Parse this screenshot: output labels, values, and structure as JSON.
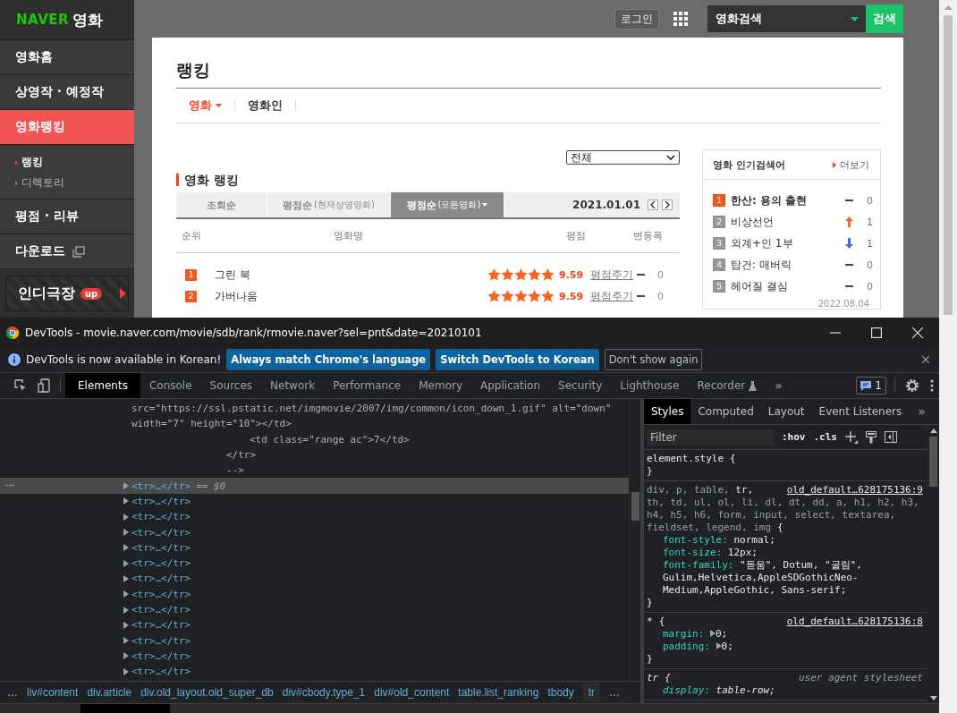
{
  "header": {
    "login": "로그인",
    "search": {
      "value": "영화검색",
      "button": "검색"
    }
  },
  "sidebar": {
    "logo": {
      "brand": "NAVER",
      "service": "영화"
    },
    "items": [
      {
        "label": "영화홈",
        "selected": false
      },
      {
        "label": "상영작 · 예정작",
        "selected": false
      },
      {
        "label": "영화랭킹",
        "selected": true,
        "children": [
          {
            "label": "랭킹",
            "selected": true
          },
          {
            "label": "디렉토리",
            "selected": false
          }
        ]
      },
      {
        "label": "평점 · 리뷰",
        "selected": false
      },
      {
        "label": "다운로드",
        "selected": false,
        "kind": "external"
      }
    ],
    "promo": {
      "label": "인디극장",
      "badge": "up"
    }
  },
  "page": {
    "title": "랭킹",
    "tabs": [
      {
        "label": "영화",
        "selected": true
      },
      {
        "label": "영화인",
        "selected": false
      }
    ],
    "filter": "전체",
    "ranking": {
      "title": "영화 랭킹",
      "sorts": [
        {
          "label": "조회순",
          "selected": false
        },
        {
          "label": "평점순",
          "note": "(현재상영영화)",
          "selected": false
        },
        {
          "label": "평점순",
          "note": "(모든영화)",
          "selected": true
        }
      ],
      "date": "2021.01.01",
      "columns": [
        "순위",
        "영화명",
        "평점",
        "변동폭"
      ],
      "rows": [
        {
          "rank": "1",
          "title": "그린 북",
          "stars": 5,
          "score": "9.59",
          "action": "평점주기",
          "kind": "same",
          "change": "0"
        },
        {
          "rank": "2",
          "title": "가버나움",
          "stars": 5,
          "score": "9.59",
          "action": "평점주기",
          "kind": "same",
          "change": "0"
        }
      ]
    },
    "popular": {
      "title": "영화 인기검색어",
      "more": "더보기",
      "items": [
        {
          "rank": "1",
          "title": "한산: 용의 출현",
          "selected": true,
          "kind": "same",
          "change": "0"
        },
        {
          "rank": "2",
          "title": "비상선언",
          "selected": false,
          "kind": "up",
          "change": "1"
        },
        {
          "rank": "3",
          "title": "외계+인 1부",
          "selected": false,
          "kind": "down",
          "change": "1"
        },
        {
          "rank": "4",
          "title": "탑건: 매버릭",
          "selected": false,
          "kind": "same",
          "change": "0"
        },
        {
          "rank": "5",
          "title": "헤어질 결심",
          "selected": false,
          "kind": "same",
          "change": "0"
        }
      ],
      "date": "2022.08.04"
    }
  },
  "devtools": {
    "title": "DevTools - movie.naver.com/movie/sdb/rank/rmovie.naver?sel=pnt&date=20210101",
    "infobar": {
      "message": "DevTools is now available in Korean!",
      "buttons": [
        {
          "label": "Always match Chrome's language",
          "kind": "primary"
        },
        {
          "label": "Switch DevTools to Korean",
          "kind": "primary"
        },
        {
          "label": "Don't show again",
          "kind": "secondary"
        }
      ]
    },
    "tabs": [
      {
        "label": "Elements",
        "selected": true
      },
      {
        "label": "Console",
        "selected": false
      },
      {
        "label": "Sources",
        "selected": false
      },
      {
        "label": "Network",
        "selected": false
      },
      {
        "label": "Performance",
        "selected": false
      },
      {
        "label": "Memory",
        "selected": false
      },
      {
        "label": "Application",
        "selected": false
      },
      {
        "label": "Security",
        "selected": false
      },
      {
        "label": "Lighthouse",
        "selected": false
      },
      {
        "label": "Recorder",
        "selected": false,
        "kind": "experimental"
      }
    ],
    "more_tabs": "»",
    "issues": "1",
    "elements": {
      "lines": [
        {
          "kind": "attr",
          "text": "src=\"https://ssl.pstatic.net/imgmovie/2007/img/common/icon_down_1.gif\" alt=\"down\""
        },
        {
          "kind": "attr",
          "text": "width=\"7\" height=\"10\"></td>"
        },
        {
          "kind": "child",
          "text": "<td class=\"range ac\">7</td>"
        },
        {
          "kind": "close",
          "text": "</tr>"
        },
        {
          "kind": "close",
          "text": "-->"
        },
        {
          "kind": "node",
          "text": "<tr>…</tr>",
          "selected": true,
          "suffix": "== $0"
        },
        {
          "kind": "node",
          "text": "<tr>…</tr>",
          "selected": false
        },
        {
          "kind": "node",
          "text": "<tr>…</tr>",
          "selected": false
        },
        {
          "kind": "node",
          "text": "<tr>…</tr>",
          "selected": false
        },
        {
          "kind": "node",
          "text": "<tr>…</tr>",
          "selected": false
        },
        {
          "kind": "node",
          "text": "<tr>…</tr>",
          "selected": false
        },
        {
          "kind": "node",
          "text": "<tr>…</tr>",
          "selected": false
        },
        {
          "kind": "node",
          "text": "<tr>…</tr>",
          "selected": false
        },
        {
          "kind": "node",
          "text": "<tr>…</tr>",
          "selected": false
        },
        {
          "kind": "node",
          "text": "<tr>…</tr>",
          "selected": false
        },
        {
          "kind": "node",
          "text": "<tr>…</tr>",
          "selected": false
        },
        {
          "kind": "node",
          "text": "<tr>…</tr>",
          "selected": false
        },
        {
          "kind": "node",
          "text": "<tr>…</tr>",
          "selected": false
        }
      ]
    },
    "styles": {
      "tabs": [
        {
          "label": "Styles",
          "selected": true
        },
        {
          "label": "Computed",
          "selected": false
        },
        {
          "label": "Layout",
          "selected": false
        },
        {
          "label": "Event Listeners",
          "selected": false
        }
      ],
      "more_tabs": "»",
      "filter": {
        "placeholder": "Filter"
      },
      "hov": ":hov",
      "cls": ".cls",
      "rules": [
        {
          "kind": "author",
          "selector": [
            {
              "text": "element.style",
              "matched": true
            }
          ],
          "open": "{",
          "close": "}"
        },
        {
          "kind": "author",
          "source": "old_default…628175136:9",
          "selector": [
            {
              "text": "div, p, table, ",
              "matched": false
            },
            {
              "text": "tr,",
              "matched": true
            },
            {
              "text": " th, td, ul, ol, li, dl, dt, dd, a, h1, h2, h3, h4, h5, h6, form, input, select, textarea, fieldset, legend, img",
              "matched": false
            }
          ],
          "open": "{",
          "close": "}",
          "properties": [
            {
              "name": "font-style:",
              "value": "normal;",
              "expandable": false
            },
            {
              "name": "font-size:",
              "value": "12px;",
              "expandable": false
            },
            {
              "name": "font-family:",
              "value": "\"돋움\", Dotum, \"굴림\", Gulim,Helvetica,AppleSDGothicNeo-Medium,AppleGothic, Sans-serif;",
              "expandable": false
            }
          ]
        },
        {
          "kind": "author",
          "source": "old_default…628175136:8",
          "selector": [
            {
              "text": "*",
              "matched": true
            }
          ],
          "open": "{",
          "close": "}",
          "properties": [
            {
              "name": "margin:",
              "value": "0;",
              "expandable": true
            },
            {
              "name": "padding:",
              "value": "0;",
              "expandable": true
            }
          ]
        },
        {
          "kind": "user-agent",
          "source": "user agent stylesheet",
          "selector": [
            {
              "text": "tr",
              "matched": true
            }
          ],
          "open": "{",
          "properties": [
            {
              "name": "display:",
              "value": "table-row;",
              "expandable": false
            }
          ]
        }
      ]
    },
    "breadcrumbs": {
      "more": "…",
      "items": [
        {
          "label": "liv#content",
          "selected": false
        },
        {
          "label": "div.article",
          "selected": false
        },
        {
          "label": "div.old_layout.old_super_db",
          "selected": false
        },
        {
          "label": "div#cbody.type_1",
          "selected": false
        },
        {
          "label": "div#old_content",
          "selected": false
        },
        {
          "label": "table.list_ranking",
          "selected": false
        },
        {
          "label": "tbody",
          "selected": false
        },
        {
          "label": "tr",
          "selected": true
        }
      ],
      "end": "…"
    }
  }
}
